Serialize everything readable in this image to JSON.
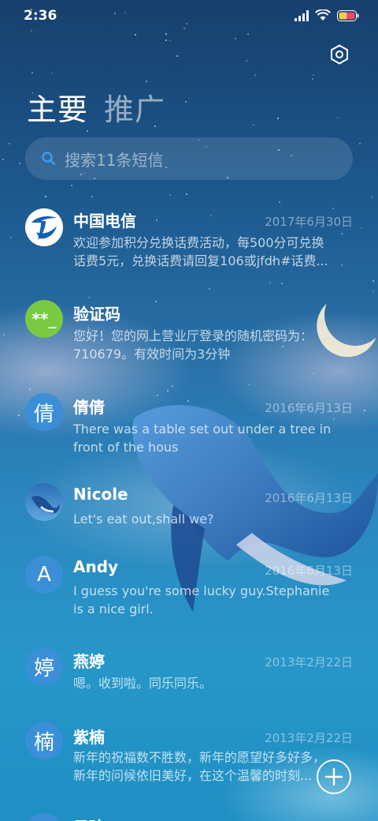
{
  "status_bar": {
    "time": "2:36"
  },
  "tabs": [
    {
      "label": "主要",
      "active": true
    },
    {
      "label": "推广",
      "active": false
    }
  ],
  "search": {
    "placeholder": "搜索11条短信"
  },
  "conversations": [
    {
      "name": "中国电信",
      "date": "2017年6月30日",
      "avatar": "china-telecom-logo",
      "preview": [
        "欢迎参加积分兑换话费活动，每500分可兑换",
        "话费5元，兑换话费请回复106或jfdh#话费..."
      ]
    },
    {
      "name": "验证码",
      "date": "",
      "avatar_text": "**_",
      "avatar_color": "#7ac943",
      "preview": [
        "您好！您的网上营业厅登录的随机密码为：",
        "710679。有效时间为3分钟"
      ]
    },
    {
      "name": "倩倩",
      "date": "2016年6月13日",
      "avatar_text": "倩",
      "avatar_color": "#3a8fd8",
      "preview": [
        "There was a table set out under a tree in",
        "front of the hous"
      ]
    },
    {
      "name": "Nicole",
      "date": "2016年6月13日",
      "avatar": "whale-photo",
      "preview": [
        "Let's eat out,shall we?"
      ]
    },
    {
      "name": "Andy",
      "date": "2016年6月13日",
      "avatar_text": "A",
      "avatar_color": "#3a8fd8",
      "preview": [
        "I guess you're some lucky guy.Stephanie",
        "is a nice girl."
      ]
    },
    {
      "name": "燕婷",
      "date": "2013年2月22日",
      "avatar_text": "婷",
      "avatar_color": "#3a8fd8",
      "preview": [
        "嗯。收到啦。同乐同乐。"
      ]
    },
    {
      "name": "紫楠",
      "date": "2013年2月22日",
      "avatar_text": "楠",
      "avatar_color": "#3a8fd8",
      "preview": [
        "新年的祝福数不胜数，新年的愿望好多好多，",
        "新年的问候依旧美好，在这个温馨的时刻..."
      ]
    },
    {
      "name": "子玲",
      "date": "",
      "avatar_text": "",
      "avatar_color": "#3a8fd8",
      "preview": []
    }
  ],
  "icons": {
    "settings": "settings-icon",
    "search": "search-icon",
    "compose": "plus-icon"
  },
  "colors": {
    "accent": "#3a8fd8",
    "verify_avatar": "#7ac943"
  }
}
